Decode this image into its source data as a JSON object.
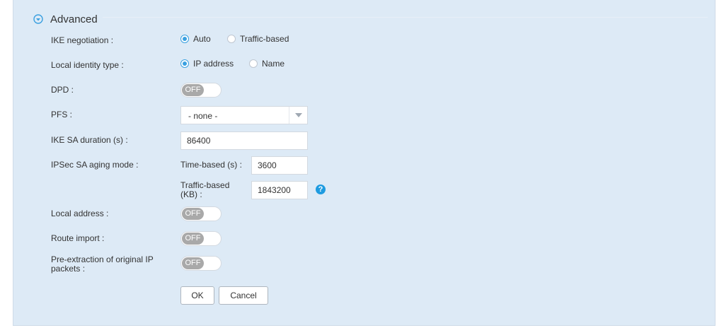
{
  "section": {
    "title": "Advanced",
    "icon": "chevron-down-circle-icon"
  },
  "ike_negotiation": {
    "label": "IKE negotiation :",
    "options": [
      {
        "label": "Auto",
        "selected": true
      },
      {
        "label": "Traffic-based",
        "selected": false
      }
    ]
  },
  "local_identity": {
    "label": "Local identity type :",
    "options": [
      {
        "label": "IP address",
        "selected": true
      },
      {
        "label": "Name",
        "selected": false
      }
    ]
  },
  "dpd": {
    "label": "DPD :",
    "state": "OFF"
  },
  "pfs": {
    "label": "PFS :",
    "value": "- none -"
  },
  "ike_sa_duration": {
    "label": "IKE SA duration (s) :",
    "value": "86400"
  },
  "ipsec_sa_aging": {
    "label": "IPSec SA aging mode :",
    "time_label": "Time-based (s) :",
    "time_value": "3600",
    "traffic_label_line1": "Traffic-based",
    "traffic_label_line2": "(KB) :",
    "traffic_value": "1843200",
    "help_icon": "help-icon",
    "help_glyph": "?"
  },
  "local_address": {
    "label": "Local address :",
    "state": "OFF"
  },
  "route_import": {
    "label": "Route import :",
    "state": "OFF"
  },
  "pre_extraction": {
    "label_line1": "Pre-extraction of original IP",
    "label_line2": "packets :",
    "state": "OFF"
  },
  "buttons": {
    "ok": "OK",
    "cancel": "Cancel"
  },
  "colors": {
    "panel_bg": "#ddeaf6",
    "accent": "#3aa0e0",
    "help": "#1e9be0",
    "toggle_off": "#a9a9a9"
  }
}
